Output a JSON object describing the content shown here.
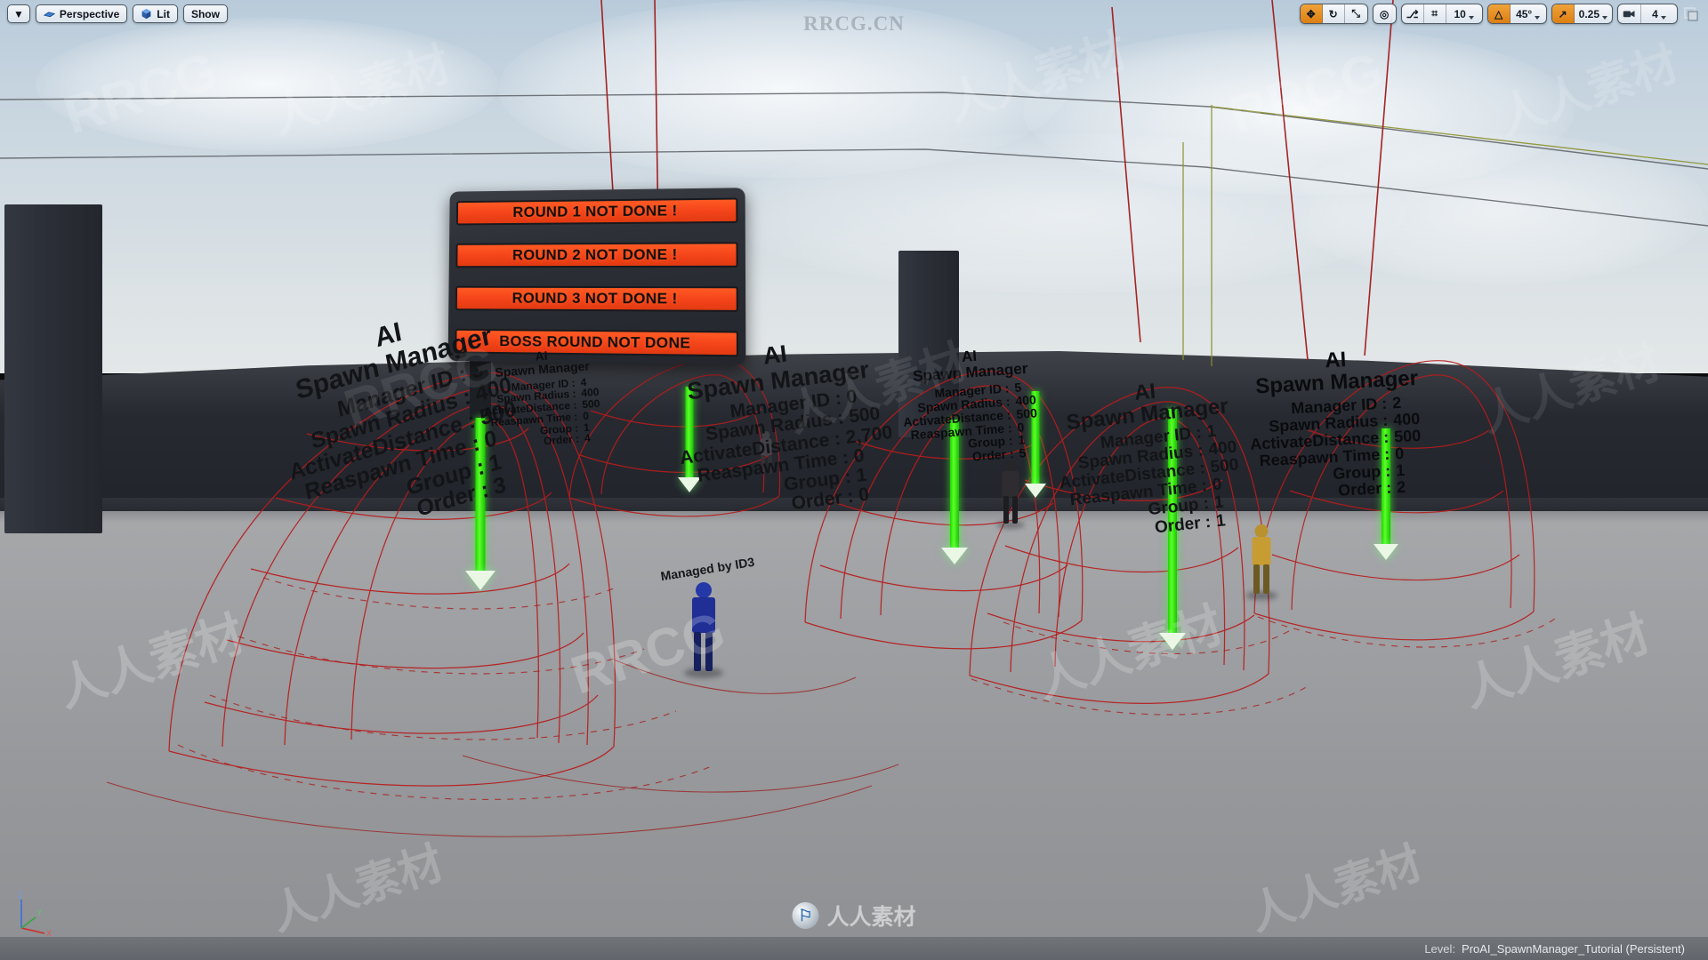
{
  "app": {
    "level_label": "Level:",
    "level_name": "ProAI_SpawnManager_Tutorial (Persistent)"
  },
  "toolbar_left": {
    "caret": "▼",
    "view_mode_label": "Perspective",
    "lighting_label": "Lit",
    "show_label": "Show",
    "icons": {
      "perspective": "perspective-icon",
      "lit": "cube-icon"
    }
  },
  "toolbar_right": {
    "transform_tools": [
      {
        "name": "select-move",
        "glyph": "✥",
        "active": true
      },
      {
        "name": "rotate",
        "glyph": "↻",
        "active": false
      },
      {
        "name": "scale",
        "glyph": "⤡",
        "active": false
      }
    ],
    "coordinate_system": {
      "name": "world-coordinate",
      "glyph": "◎",
      "active": false
    },
    "surface_snap": {
      "name": "surface-snap",
      "glyph": "⎇",
      "active": false
    },
    "grid_snap": {
      "name": "grid-snap",
      "glyph": "⌗",
      "active": false,
      "value": "10"
    },
    "angle_snap": {
      "name": "angle-snap",
      "glyph": "△",
      "active": true,
      "value": "45°"
    },
    "scale_snap": {
      "name": "scale-snap",
      "glyph": "↗",
      "active": true,
      "value": "0.25"
    },
    "camera_speed": {
      "name": "camera-speed",
      "glyph": "Ἲ5",
      "active": false,
      "value": "4"
    },
    "maximize": {
      "name": "maximize-viewport",
      "glyph": "❐"
    }
  },
  "scoreboard": {
    "rows": [
      "ROUND 1 NOT DONE !",
      "ROUND 2 NOT DONE !",
      "ROUND 3 NOT DONE !",
      "BOSS ROUND NOT DONE"
    ],
    "panel_color": "#ff4a18",
    "text_color": "#120b06"
  },
  "param_labels": {
    "manager_id": "Manager ID :",
    "spawn_radius": "Spawn Radius :",
    "activate_distance": "ActivateDistance :",
    "respawn_time": "Reaspawn Time :",
    "group": "Group :",
    "order": "Order :"
  },
  "managers": [
    {
      "id": "mgr-left",
      "title": "AI",
      "subtitle": "Spawn Manager",
      "values": {
        "manager_id": "3",
        "spawn_radius": "400",
        "activate_distance": "500",
        "respawn_time": "0",
        "group": "1",
        "order": "3"
      }
    },
    {
      "id": "mgr-second",
      "title": "AI",
      "subtitle": "Spawn Manager",
      "values": {
        "manager_id": "4",
        "spawn_radius": "400",
        "activate_distance": "500",
        "respawn_time": "0",
        "group": "1",
        "order": "4"
      }
    },
    {
      "id": "mgr-mid",
      "title": "AI",
      "subtitle": "Spawn Manager",
      "values": {
        "manager_id": "0",
        "spawn_radius": "500",
        "activate_distance": "2,700",
        "respawn_time": "0",
        "group": "1",
        "order": "0"
      }
    },
    {
      "id": "mgr-mid2",
      "title": "AI",
      "subtitle": "Spawn Manager",
      "values": {
        "manager_id": "5",
        "spawn_radius": "400",
        "activate_distance": "500",
        "respawn_time": "0",
        "group": "1",
        "order": "5"
      }
    },
    {
      "id": "mgr-right",
      "title": "AI",
      "subtitle": "Spawn Manager",
      "values": {
        "manager_id": "1",
        "spawn_radius": "400",
        "activate_distance": "500",
        "respawn_time": "0",
        "group": "1",
        "order": "1"
      }
    },
    {
      "id": "mgr-far",
      "title": "AI",
      "subtitle": "Spawn Manager",
      "values": {
        "manager_id": "2",
        "spawn_radius": "400",
        "activate_distance": "500",
        "respawn_time": "0",
        "group": "1",
        "order": "2"
      }
    }
  ],
  "actor_labels": {
    "managed_by": "Managed by ID3"
  },
  "axis_gizmo": {
    "x": "X",
    "y": "Y",
    "z": "Z"
  },
  "watermarks": {
    "top_center": "RRCG.CN",
    "bottom_brand": "人人素材",
    "tile": "人人素材",
    "tile_latin": "RRCG"
  },
  "colors": {
    "accent_orange": "#e08318",
    "debug_red": "#c01b1b",
    "arrow_green": "#3cff1e",
    "sky_top": "#b9cbda",
    "floor": "#9fa1a4",
    "wall": "#262930"
  }
}
